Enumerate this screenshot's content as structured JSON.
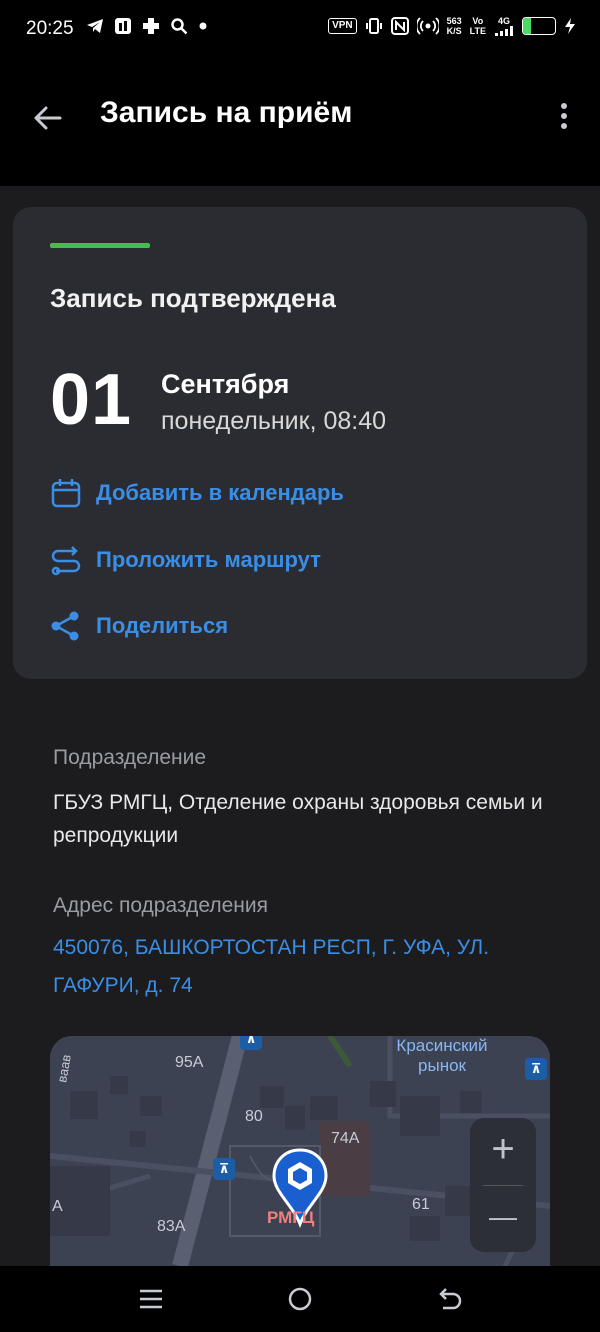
{
  "status_bar": {
    "time": "20:25",
    "vpn": "VPN",
    "speed_value": "563",
    "speed_unit": "K/S",
    "vo_top": "Vo",
    "vo_bottom": "LTE",
    "network": "4G",
    "battery": "26",
    "battery_level": 0.26
  },
  "app_bar": {
    "title": "Запись на приём"
  },
  "card": {
    "status": "Запись подтверждена",
    "day": "01",
    "month": "Сентября",
    "weekday_time": "понедельник, 08:40",
    "actions": [
      {
        "label": "Добавить в календарь",
        "icon": "calendar-icon"
      },
      {
        "label": "Проложить маршрут",
        "icon": "route-icon"
      },
      {
        "label": "Поделиться",
        "icon": "share-icon"
      }
    ],
    "accent": "#3ec04a"
  },
  "details": {
    "department_label": "Подразделение",
    "department_value": "ГБУЗ РМГЦ, Отделение охраны здоровья семьи и репродукции",
    "address_label": "Адрес подразделения",
    "address_value": "450076, БАШКОРТОСТАН РЕСП, Г. УФА, УЛ. ГАФУРИ, д. 74"
  },
  "map": {
    "labels": {
      "market": "Красинский рынок",
      "b95a": "95А",
      "b80": "80",
      "b74a": "74А",
      "b61": "61",
      "b83a": "83А",
      "a": "А",
      "street": "ваав",
      "pin": "РМГЦ"
    },
    "zoom_in": "+",
    "zoom_out": "—"
  },
  "colors": {
    "link": "#3a8ee6",
    "background": "#1c1c1f",
    "card": "#2b2c31"
  }
}
